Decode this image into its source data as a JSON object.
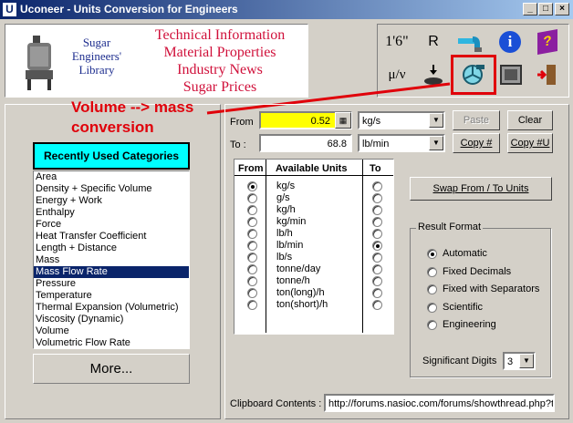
{
  "window": {
    "title": "Uconeer - Units Conversion for Engineers",
    "icon_letter": "U",
    "buttons": {
      "minimize": "_",
      "maximize": "□",
      "close": "×"
    }
  },
  "banner": {
    "library_lines": [
      "Sugar",
      "Engineers'",
      "Library"
    ],
    "links": [
      "Technical Information",
      "Material Properties",
      "Industry News",
      "Sugar Prices"
    ]
  },
  "toolbar": {
    "buttons": [
      {
        "name": "feet-inches-icon",
        "label": "1'6\""
      },
      {
        "name": "gas-constant-icon",
        "label": "R"
      },
      {
        "name": "pipe-flow-icon",
        "label": ""
      },
      {
        "name": "info-icon",
        "label": "i"
      },
      {
        "name": "help-book-icon",
        "label": "?"
      },
      {
        "name": "viscosity-icon",
        "label": "μ/ν"
      },
      {
        "name": "weight-icon",
        "label": ""
      },
      {
        "name": "volume-to-mass-icon",
        "label": ""
      },
      {
        "name": "calculator-icon",
        "label": ""
      },
      {
        "name": "exit-icon",
        "label": ""
      }
    ]
  },
  "annotation": {
    "lines": [
      "Volume --> mass",
      "conversion"
    ],
    "color": "#e0000a"
  },
  "categories": {
    "header": "Recently Used Categories",
    "items": [
      "Area",
      "Density + Specific Volume",
      "Energy + Work",
      "Enthalpy",
      "Force",
      "Heat Transfer Coefficient",
      "Length + Distance",
      "Mass",
      "Mass Flow Rate",
      "Pressure",
      "Temperature",
      "Thermal Expansion (Volumetric)",
      "Viscosity (Dynamic)",
      "Volume",
      "Volumetric Flow Rate"
    ],
    "selected": "Mass Flow Rate",
    "more_button": "More..."
  },
  "converter": {
    "from_label": "From",
    "to_label": "To :",
    "from_value": "0.52",
    "from_unit": "kg/s",
    "to_value": "68.8",
    "to_unit": "lb/min",
    "buttons": {
      "paste": "Paste",
      "clear": "Clear",
      "copy_num": "Copy #",
      "copy_num_unit": "Copy #U"
    }
  },
  "units_table": {
    "headers": {
      "from": "From",
      "units": "Available Units",
      "to": "To"
    },
    "units": [
      "kg/s",
      "g/s",
      "kg/h",
      "kg/min",
      "lb/h",
      "lb/min",
      "lb/s",
      "tonne/day",
      "tonne/h",
      "ton(long)/h",
      "ton(short)/h"
    ],
    "from_selected": 0,
    "to_selected": 5
  },
  "swap_button": "Swap From / To Units",
  "result_format": {
    "title": "Result Format",
    "options": [
      "Automatic",
      "Fixed Decimals",
      "Fixed with Separators",
      "Scientific",
      "Engineering"
    ],
    "selected": 0,
    "sig_digits_label": "Significant Digits",
    "sig_digits_value": "3"
  },
  "clipboard": {
    "label": "Clipboard Contents :",
    "value": "http://forums.nasioc.com/forums/showthread.php?t="
  }
}
